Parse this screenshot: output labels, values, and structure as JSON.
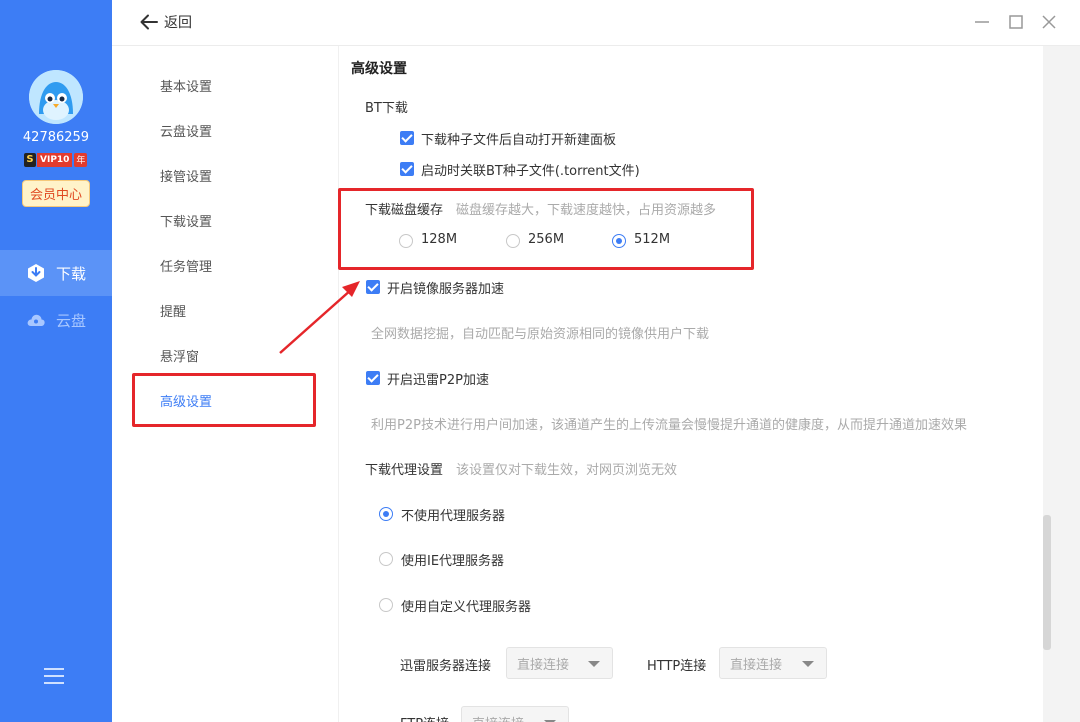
{
  "user": {
    "id": "42786259",
    "vip_mark": "S",
    "vip_label": "VIP10",
    "vip_suffix": "年",
    "member_center": "会员中心"
  },
  "left_nav": [
    {
      "label": "下载",
      "icon": "download-icon"
    },
    {
      "label": "云盘",
      "icon": "cloud-icon"
    }
  ],
  "topbar": {
    "back_label": "返回"
  },
  "settings_nav": [
    "基本设置",
    "云盘设置",
    "接管设置",
    "下载设置",
    "任务管理",
    "提醒",
    "悬浮窗",
    "高级设置"
  ],
  "content": {
    "section_title": "高级设置",
    "bt": {
      "heading": "BT下载",
      "option1": "下载种子文件后自动打开新建面板",
      "option2": "启动时关联BT种子文件(.torrent文件)"
    },
    "cache": {
      "label": "下载磁盘缓存",
      "hint": "磁盘缓存越大，下载速度越快，占用资源越多",
      "options": [
        "128M",
        "256M",
        "512M"
      ],
      "selected": "512M"
    },
    "mirror": {
      "label": "开启镜像服务器加速",
      "hint": "全网数据挖掘，自动匹配与原始资源相同的镜像供用户下载"
    },
    "p2p": {
      "label": "开启迅雷P2P加速",
      "hint": "利用P2P技术进行用户间加速，该通道产生的上传流量会慢慢提升通道的健康度，从而提升通道加速效果"
    },
    "proxy": {
      "label": "下载代理设置",
      "hint": "该设置仅对下载生效，对网页浏览无效",
      "options": [
        "不使用代理服务器",
        "使用IE代理服务器",
        "使用自定义代理服务器"
      ],
      "selected": "不使用代理服务器",
      "xunlei_conn_label": "迅雷服务器连接",
      "xunlei_conn_value": "直接连接",
      "http_conn_label": "HTTP连接",
      "http_conn_value": "直接连接",
      "ftp_conn_label": "FTP连接",
      "ftp_conn_value": "直接连接"
    }
  },
  "colors": {
    "accent": "#3d7df5",
    "sidebar": "#3d7df5",
    "annotation_red": "#e5262a"
  }
}
